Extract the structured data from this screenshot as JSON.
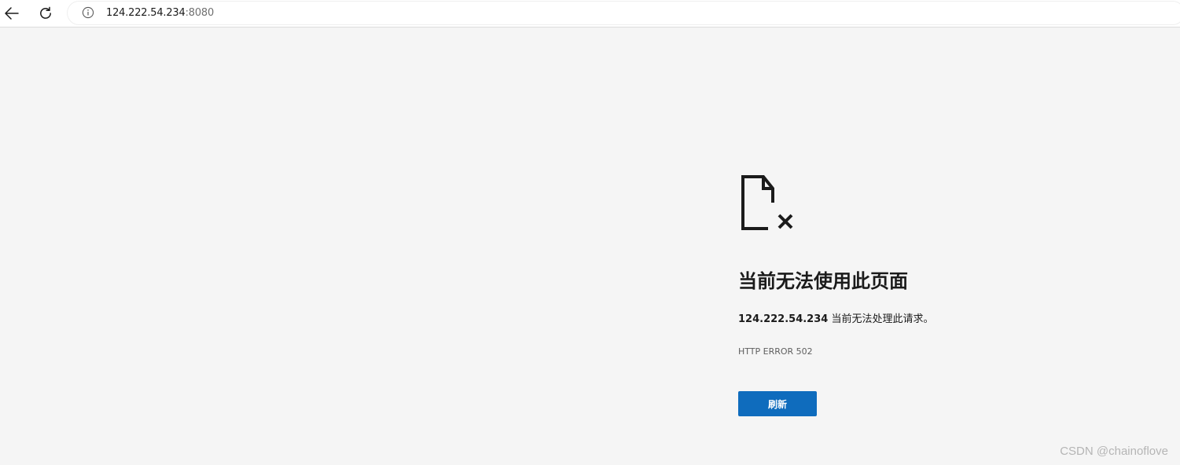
{
  "toolbar": {
    "back_icon": "arrow-left-icon",
    "reload_icon": "reload-icon",
    "info_icon": "info-circle-icon",
    "url_host": "124.222.54.234",
    "url_port": ":8080"
  },
  "error_page": {
    "icon": "broken-document-icon",
    "title": "当前无法使用此页面",
    "desc_host": "124.222.54.234",
    "desc_text": " 当前无法处理此请求。",
    "error_code": "HTTP ERROR 502",
    "refresh_label": "刷新",
    "accent_color": "#0f6cbd"
  },
  "watermark": "CSDN @chainoflove"
}
